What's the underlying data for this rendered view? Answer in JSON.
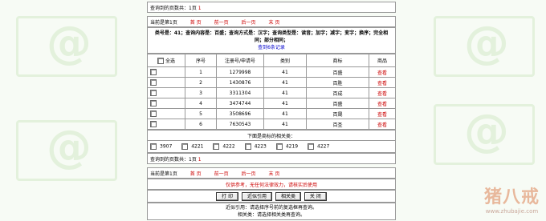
{
  "top_bar": {
    "label": "查询到的页数共：1页",
    "count": "1"
  },
  "nav": {
    "current": "当前是第1页",
    "first": "首 页",
    "prev": "前一页",
    "next": "后一页",
    "last": "末 页"
  },
  "query": {
    "conditions": "类号是：41；查询内容是：百盛；查询方式是：汉字；查询类型是：读音；加字；减字；变字；换序；完全相同；部分相同；",
    "found": "查到6条记录"
  },
  "table": {
    "headers": {
      "select_all": "全选",
      "index": "序号",
      "reg_no": "注册号/申请号",
      "class": "类别",
      "mark": "商标",
      "goods": "商品"
    },
    "rows": [
      {
        "index": "1",
        "reg_no": "1279998",
        "class": "41",
        "mark": "百盛",
        "goods": "查看"
      },
      {
        "index": "2",
        "reg_no": "1430876",
        "class": "41",
        "mark": "百胜",
        "goods": "查看"
      },
      {
        "index": "3",
        "reg_no": "3311304",
        "class": "41",
        "mark": "百成",
        "goods": "查看"
      },
      {
        "index": "4",
        "reg_no": "3474744",
        "class": "41",
        "mark": "百盛",
        "goods": "查看"
      },
      {
        "index": "5",
        "reg_no": "3508696",
        "class": "41",
        "mark": "百晟",
        "goods": "查看"
      },
      {
        "index": "6",
        "reg_no": "7630543",
        "class": "41",
        "mark": "百圣",
        "goods": "查看"
      }
    ]
  },
  "related": {
    "title": "下面是商标的相关类：",
    "items": [
      "3907",
      "4221",
      "4222",
      "4223",
      "4219",
      "4227"
    ]
  },
  "notice": "仅供参考，无任何法律效力，请核实后使用",
  "buttons": {
    "print": "打 印",
    "recent": "近似引用",
    "related": "相关类",
    "close": "关 闭"
  },
  "help": {
    "line1": "近似引用：请选择序号前的复选框再查询。",
    "line2": "相关类：请选择相关类再查询。"
  },
  "logo": {
    "brand": "猪八戒",
    "url": "www.zhubajie.com"
  }
}
